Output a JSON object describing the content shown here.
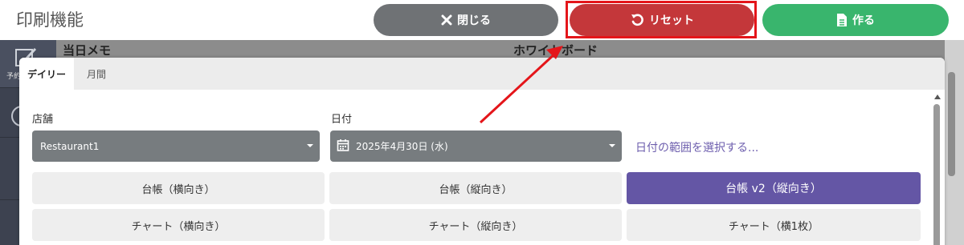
{
  "header": {
    "title": "印刷機能",
    "close_label": "閉じる",
    "reset_label": "リセット",
    "create_label": "作る"
  },
  "background": {
    "sidebar_label": "予約",
    "memo_title": "当日メモ",
    "whiteboard_title": "ホワイトボード"
  },
  "tabs": [
    {
      "label": "デイリー",
      "active": true
    },
    {
      "label": "月間",
      "active": false
    }
  ],
  "form": {
    "store_label": "店舗",
    "store_value": "Restaurant1",
    "date_label": "日付",
    "date_value": "2025年4月30日 (水)",
    "range_link": "日付の範囲を選択する..."
  },
  "print_options": [
    {
      "label": "台帳（横向き）",
      "selected": false
    },
    {
      "label": "台帳（縦向き）",
      "selected": false
    },
    {
      "label": "台帳 v2（縦向き）",
      "selected": true
    },
    {
      "label": "チャート（横向き）",
      "selected": false
    },
    {
      "label": "チャート（縦向き）",
      "selected": false
    },
    {
      "label": "チャート（横1枚）",
      "selected": false
    }
  ],
  "colors": {
    "close_button": "#6f7275",
    "reset_button": "#c4373a",
    "create_button": "#39b56d",
    "selected_option": "#6456a5",
    "annotation": "#e4151a"
  },
  "icons": {
    "close": "x-icon",
    "reset": "undo-icon",
    "create": "document-icon",
    "date": "calendar-icon"
  }
}
